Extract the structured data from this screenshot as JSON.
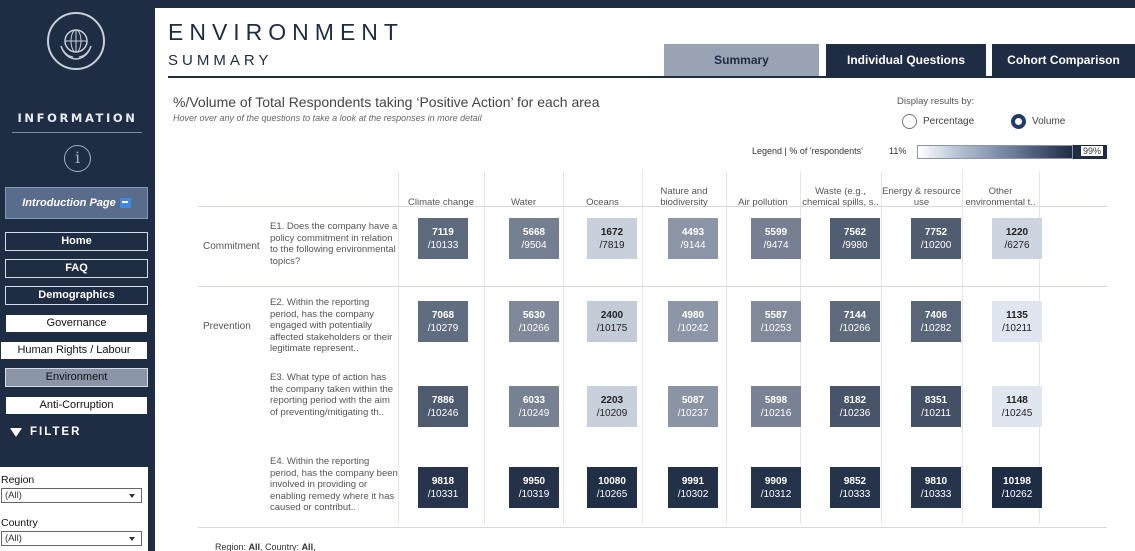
{
  "sidebar": {
    "logo_text": "UN GLOBAL COMPACT",
    "info_title": "INFORMATION",
    "info_icon": "i",
    "intro_button": "Introduction Page",
    "nav": [
      {
        "label": "Home",
        "style": "dark"
      },
      {
        "label": "FAQ",
        "style": "dark"
      },
      {
        "label": "Demographics",
        "style": "dark"
      },
      {
        "label": "Governance",
        "style": "light"
      },
      {
        "label": "Human Rights / Labour",
        "style": "light"
      },
      {
        "label": "Environment",
        "style": "active"
      },
      {
        "label": "Anti-Corruption",
        "style": "light"
      }
    ],
    "filter_title": "FILTER",
    "filters": [
      {
        "label": "Region",
        "value": "(All)"
      },
      {
        "label": "Country",
        "value": "(All)"
      }
    ]
  },
  "header": {
    "title": "ENVIRONMENT",
    "subtitle": "SUMMARY",
    "tabs": [
      {
        "label": "Summary",
        "selected": true
      },
      {
        "label": "Individual Questions",
        "selected": false
      },
      {
        "label": "Cohort Comparison",
        "selected": false
      }
    ]
  },
  "main": {
    "title": "%/Volume of Total Respondents taking ‘Positive Action’ for each area",
    "hint": "Hover over any of the questions to take a look at the responses in more detail",
    "display_label": "Display results by:",
    "display_options": [
      {
        "label": "Percentage",
        "selected": false
      },
      {
        "label": "Volume",
        "selected": true
      }
    ],
    "legend_label": "Legend | % of 'respondents'",
    "legend_min": "11%",
    "legend_max": "99%",
    "columns": [
      "Climate change",
      "Water",
      "Oceans",
      "Nature and\nbiodiversity",
      "Air pollution",
      "Waste (e.g.,\nchemical spills, s..",
      "Energy & resource\nuse",
      "Other\nenvironmental t.."
    ],
    "categories": [
      "Commitment",
      "Prevention"
    ],
    "rows": [
      {
        "category": "Commitment",
        "question": "E1. Does the company have a policy commitment in relation to the following environmental topics?",
        "cells": [
          [
            "7119",
            "/10133"
          ],
          [
            "5668",
            "/9504"
          ],
          [
            "1672",
            "/7819"
          ],
          [
            "4493",
            "/9144"
          ],
          [
            "5599",
            "/9474"
          ],
          [
            "7562",
            "/9980"
          ],
          [
            "7752",
            "/10200"
          ],
          [
            "1220",
            "/6276"
          ]
        ]
      },
      {
        "category": "Prevention",
        "question": "E2. Within the reporting period, has the company engaged with potentially affected stakeholders or their legitimate represent..",
        "cells": [
          [
            "7068",
            "/10279"
          ],
          [
            "5630",
            "/10266"
          ],
          [
            "2400",
            "/10175"
          ],
          [
            "4980",
            "/10242"
          ],
          [
            "5587",
            "/10253"
          ],
          [
            "7144",
            "/10266"
          ],
          [
            "7406",
            "/10282"
          ],
          [
            "1135",
            "/10211"
          ]
        ]
      },
      {
        "category": "",
        "question": "E3. What type of action has the company taken within the reporting period with the aim of preventing/mitigating th..",
        "cells": [
          [
            "7886",
            "/10246"
          ],
          [
            "6033",
            "/10249"
          ],
          [
            "2203",
            "/10209"
          ],
          [
            "5087",
            "/10237"
          ],
          [
            "5898",
            "/10216"
          ],
          [
            "8182",
            "/10236"
          ],
          [
            "8351",
            "/10211"
          ],
          [
            "1148",
            "/10245"
          ]
        ]
      },
      {
        "category": "",
        "question": "E4. Within the reporting period, has the company been involved in providing or enabling remedy where it has caused or contribut..",
        "cells": [
          [
            "9818",
            "/10331"
          ],
          [
            "9950",
            "/10319"
          ],
          [
            "10080",
            "/10265"
          ],
          [
            "9991",
            "/10302"
          ],
          [
            "9909",
            "/10312"
          ],
          [
            "9852",
            "/10333"
          ],
          [
            "9810",
            "/10333"
          ],
          [
            "10198",
            "/10262"
          ]
        ]
      }
    ],
    "footer_prefix_region": "Region: ",
    "footer_region": "All",
    "footer_prefix_country": ", Country: ",
    "footer_country": "All",
    "footer_suffix": ","
  },
  "colors": {
    "navy": "#1e2c44",
    "scale_low": "#dfe6f0",
    "scale_high": "#1e2c44"
  }
}
